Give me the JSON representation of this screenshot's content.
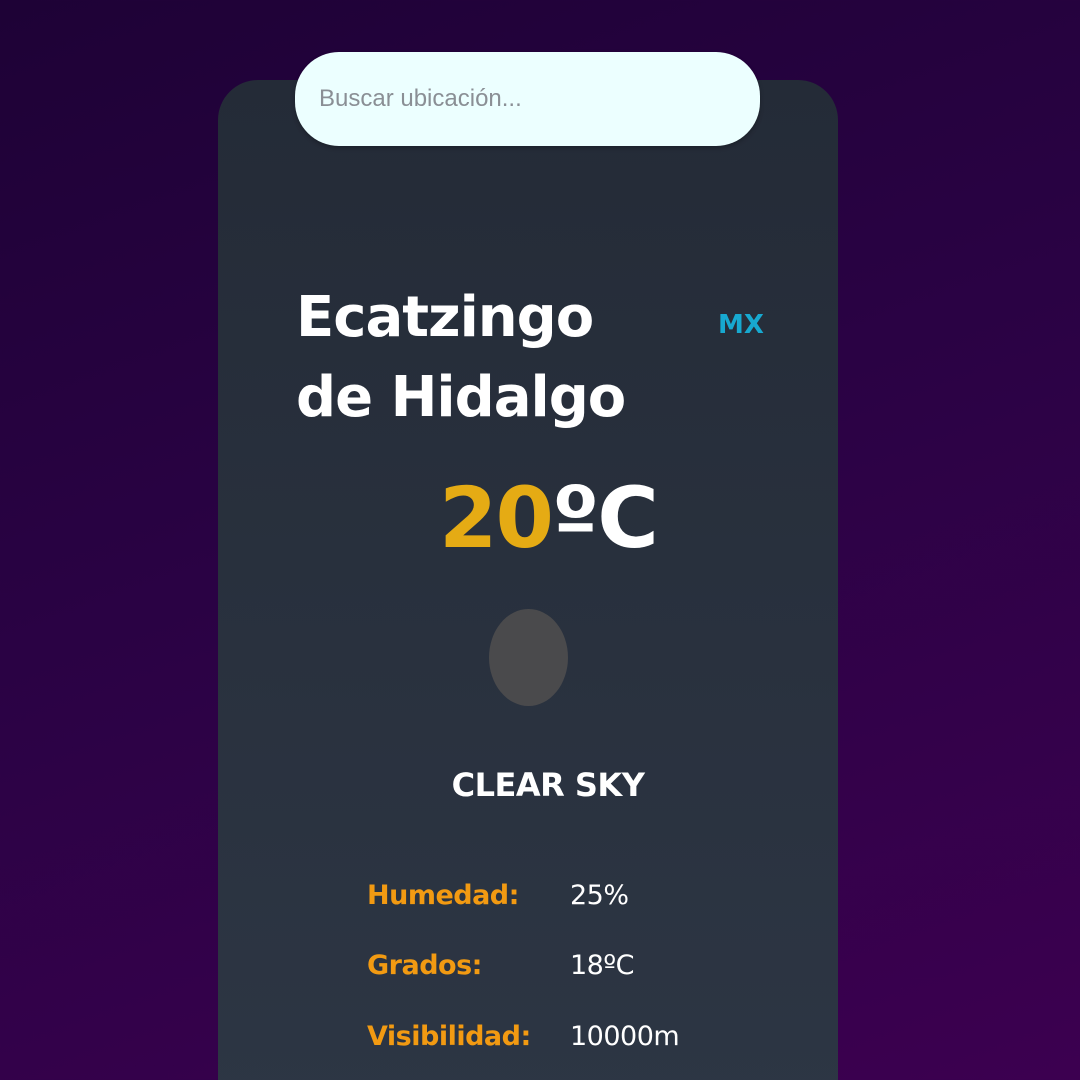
{
  "search": {
    "placeholder": "Buscar ubicación...",
    "value": ""
  },
  "location": {
    "city": "Ecatzingo de Hidalgo",
    "country": "MX"
  },
  "current": {
    "temperature_value": "20",
    "temperature_unit": "ºC",
    "description": "CLEAR SKY",
    "icon": "weather-icon-placeholder"
  },
  "details": [
    {
      "label": "Humedad:",
      "value": "25%"
    },
    {
      "label": "Grados:",
      "value": "18ºC"
    },
    {
      "label": "Visibilidad:",
      "value": "10000m"
    }
  ],
  "colors": {
    "background_top": "#1e0236",
    "background_bottom": "#3c0050",
    "card": "#2a3240",
    "search_bg": "#ecffff",
    "temperature_accent": "#e5ab14",
    "label_accent": "#f29a12",
    "country_accent": "#17a9d0"
  }
}
